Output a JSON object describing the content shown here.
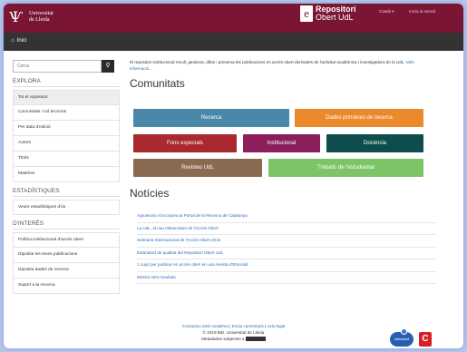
{
  "header": {
    "university_line1": "Universitat",
    "university_line2": "de Lleida",
    "repo_letter": "e",
    "repo_title1": "Repositori",
    "repo_title2": "Obert UdL",
    "lang_link": "Català ▾",
    "login_link": "Inicia la sessió"
  },
  "nav": {
    "home_label": "Inici"
  },
  "sidebar": {
    "search_placeholder": "Cerca",
    "explora_title": "EXPLORA",
    "explora_items": [
      "Tot el repositori",
      "Comunitats i col·leccions",
      "Per data d'edició",
      "Autors",
      "Títols",
      "Matèries"
    ],
    "stats_title": "ESTADÍSTIQUES",
    "stats_items": [
      "Veure estadístiques d'ús"
    ],
    "interes_title": "D'INTERÈS",
    "interes_items": [
      "Política institucional d'accés obert",
      "Diposita les teves publicacions",
      "Diposita dades de recerca",
      "Suport a la recerca"
    ]
  },
  "main": {
    "intro": "El repositori institucional recull, gestiona, difon i preserva les publicacions en accés obert derivades de l'activitat acadèmica i investigadora de la UdL.",
    "intro_more": "Més informació...",
    "communities_title": "Comunitats",
    "communities": [
      {
        "label": "Recerca",
        "color": "#4b87a9"
      },
      {
        "label": "Dades primàries de recerca",
        "color": "#ea8a2d"
      },
      {
        "label": "Fons especials",
        "color": "#a9292f"
      },
      {
        "label": "Institucional",
        "color": "#8c1f5b"
      },
      {
        "label": "Docència",
        "color": "#0e4d4b"
      },
      {
        "label": "Revistes UdL",
        "color": "#8b6a52"
      },
      {
        "label": "Treballs de l'estudiantat",
        "color": "#7dc467"
      }
    ],
    "news_title": "Notícies",
    "news": [
      "Agrotecnio s'incorpora al Portal de la Recerca de Catalunya",
      "La UdL, al nou Observatori de l'Accés Obert",
      "Setmana Internacional de l'Accés Obert 2016",
      "Estàndard de qualitat del Repositori Obert UdL",
      "1 cupó per publicar en accés obert en una revista d'Emerald",
      "Mostra més resultats"
    ]
  },
  "footer": {
    "contact": "Contacteu amb nosaltres",
    "sep1": " | ",
    "feedback": "Envia comentaris",
    "sep2": " | ",
    "legal": "Avís legal",
    "copyright": "© 2019 BiD. Universitat de Lleida",
    "license": "Metadades subjectes a",
    "badge_val": "Validated",
    "badge_c": "C"
  }
}
